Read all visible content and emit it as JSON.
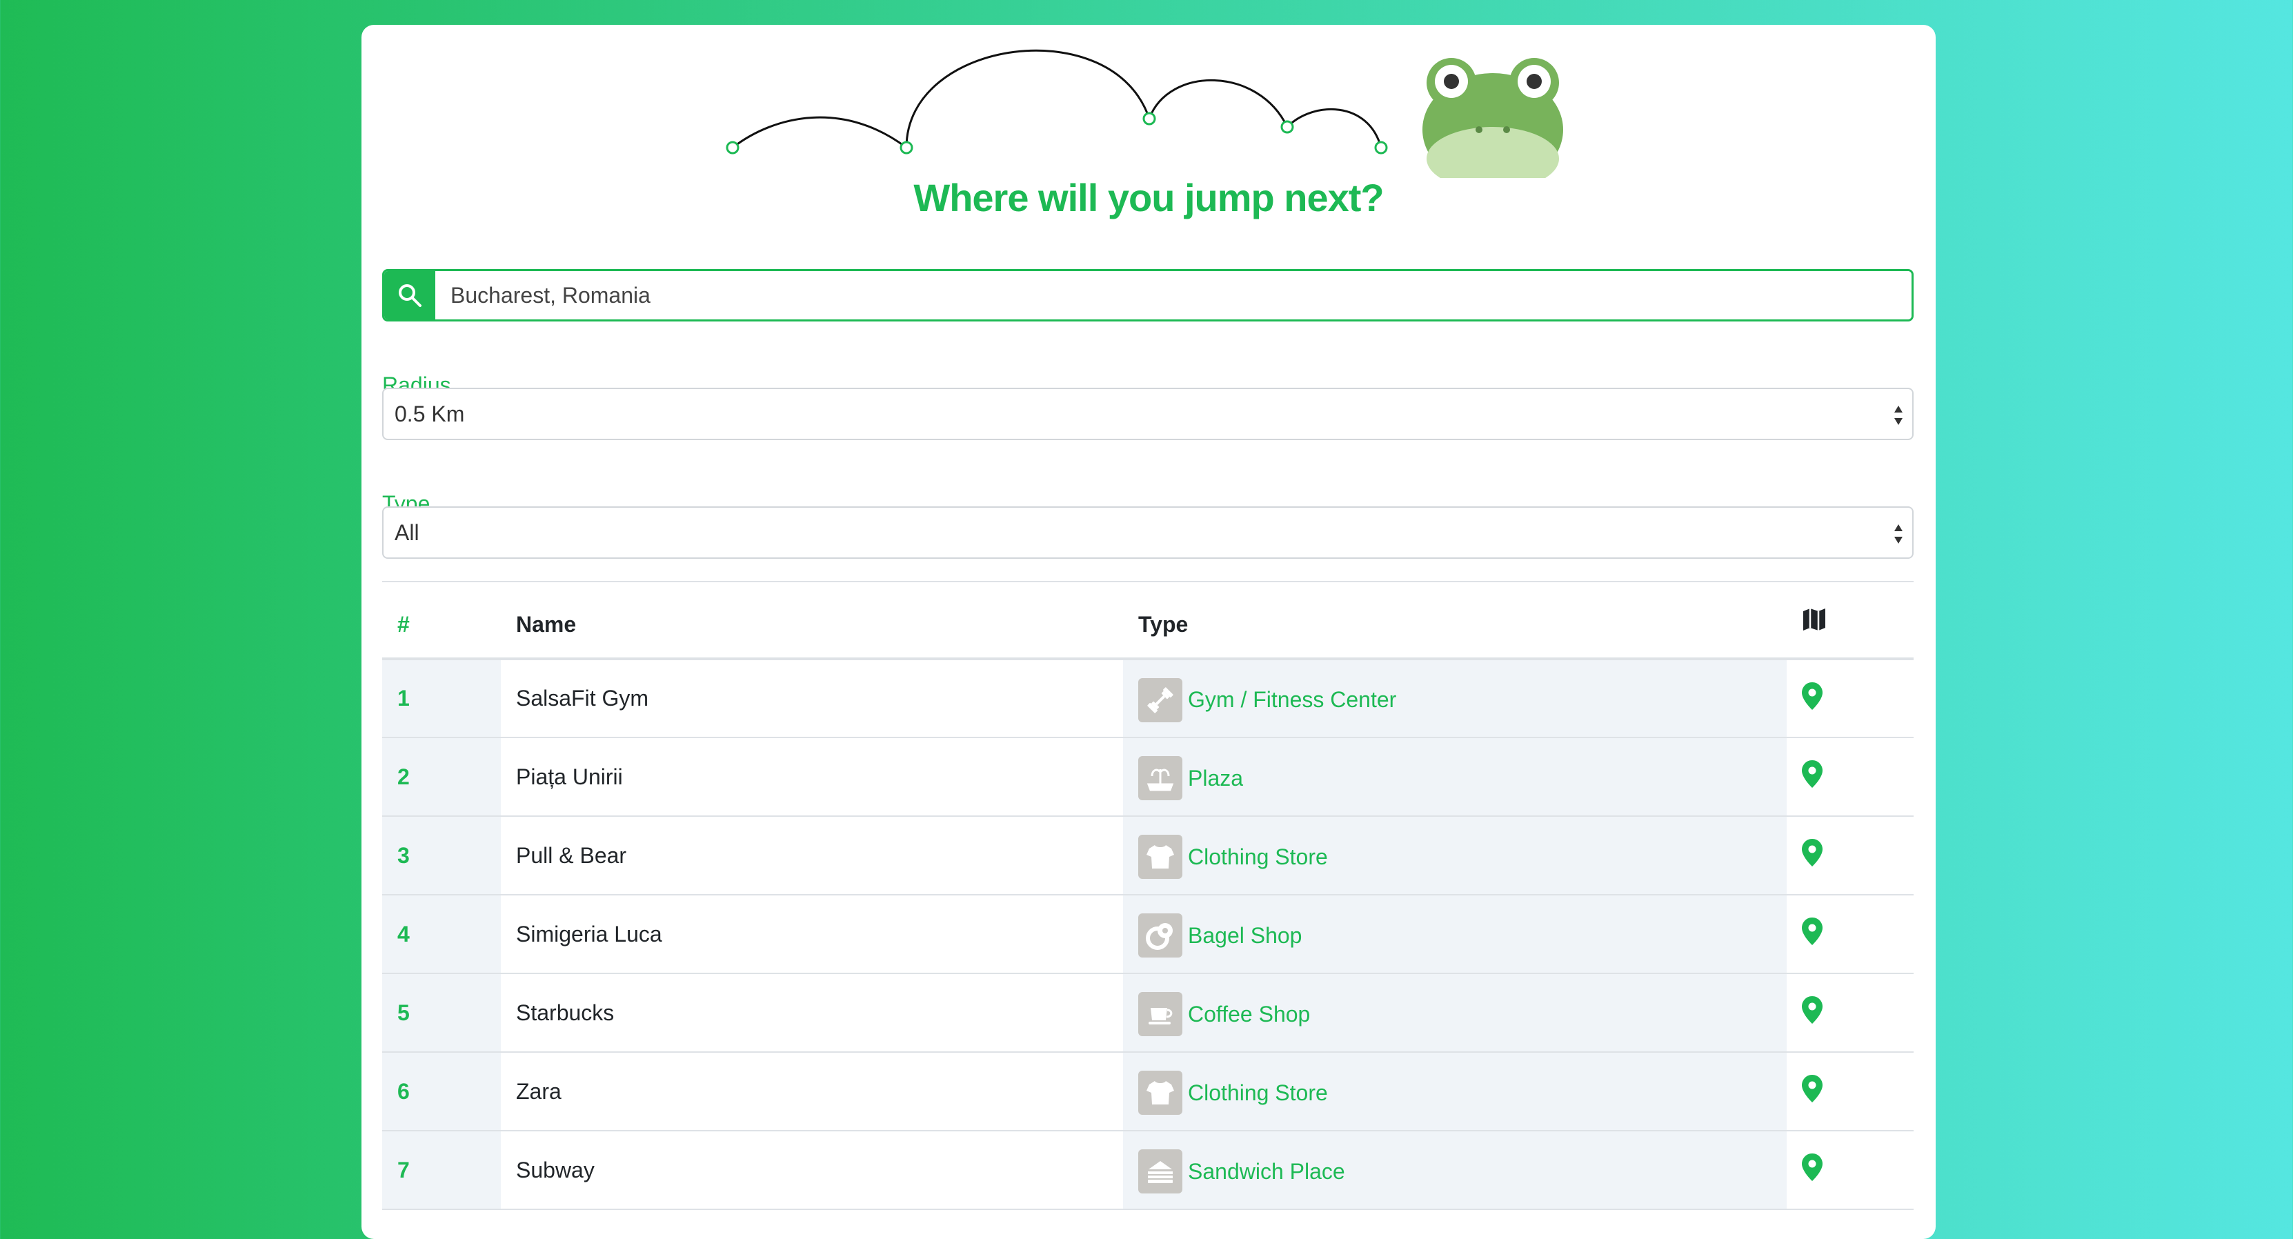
{
  "colors": {
    "accent": "#1db954",
    "stripe": "#f0f4f8",
    "icon_bg": "#c8c6c2"
  },
  "header": {
    "title": "Where will you jump next?",
    "mascot": "frog-icon"
  },
  "search": {
    "value": "Bucharest, Romania",
    "icon": "search-icon"
  },
  "filters": {
    "radius_label": "Radius",
    "radius_value": "0.5 Km",
    "type_label": "Type",
    "type_value": "All"
  },
  "table": {
    "headers": {
      "num": "#",
      "name": "Name",
      "type": "Type",
      "map": "map-icon"
    },
    "rows": [
      {
        "num": "1",
        "name": "SalsaFit Gym",
        "type": "Gym / Fitness Center",
        "icon": "dumbbell-icon"
      },
      {
        "num": "2",
        "name": "Piața Unirii",
        "type": "Plaza",
        "icon": "fountain-icon"
      },
      {
        "num": "3",
        "name": "Pull & Bear",
        "type": "Clothing Store",
        "icon": "shirt-icon"
      },
      {
        "num": "4",
        "name": "Simigeria Luca",
        "type": "Bagel Shop",
        "icon": "bagel-icon"
      },
      {
        "num": "5",
        "name": "Starbucks",
        "type": "Coffee Shop",
        "icon": "coffee-cup-icon"
      },
      {
        "num": "6",
        "name": "Zara",
        "type": "Clothing Store",
        "icon": "shirt-icon"
      },
      {
        "num": "7",
        "name": "Subway",
        "type": "Sandwich Place",
        "icon": "sandwich-icon"
      }
    ]
  }
}
